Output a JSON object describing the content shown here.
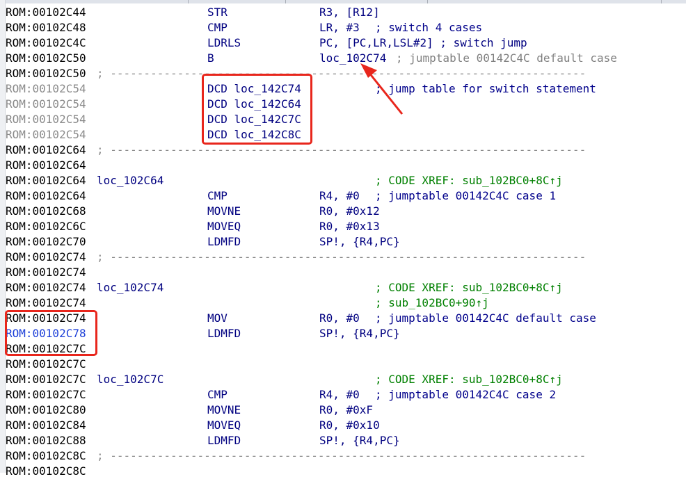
{
  "listing": [
    {
      "addr": "ROM:00102C44",
      "mn": "STR",
      "op": "R3, [R12]"
    },
    {
      "addr": "ROM:00102C48",
      "mn": "CMP",
      "op": "LR, #3",
      "cm": "; switch 4 cases"
    },
    {
      "addr": "ROM:00102C4C",
      "mn": "LDRLS",
      "op": "PC, [PC,LR,LSL#2] ; switch jump"
    },
    {
      "addr": "ROM:00102C50",
      "mn": "B",
      "op": "loc_102C74",
      "auto": "; jumptable 00142C4C default case"
    },
    {
      "addr": "ROM:00102C50",
      "sep": "; -----------------------------------------------------------------------"
    },
    {
      "addr": "ROM:00102C54",
      "dim": true,
      "mn": "DCD loc_142C74",
      "cm": "; jump table for switch statement"
    },
    {
      "addr": "ROM:00102C54",
      "dim": true,
      "mn": "DCD loc_142C64"
    },
    {
      "addr": "ROM:00102C54",
      "dim": true,
      "mn": "DCD loc_142C7C"
    },
    {
      "addr": "ROM:00102C54",
      "dim": true,
      "mn": "DCD loc_142C8C"
    },
    {
      "addr": "ROM:00102C64",
      "sep": "; -----------------------------------------------------------------------"
    },
    {
      "addr": "ROM:00102C64"
    },
    {
      "addr": "ROM:00102C64",
      "label": "loc_102C64",
      "xref": "; CODE XREF: sub_102BC0+8C↑j"
    },
    {
      "addr": "ROM:00102C64",
      "mn": "CMP",
      "op": "R4, #0",
      "cm": "; jumptable 00142C4C case 1"
    },
    {
      "addr": "ROM:00102C68",
      "mn": "MOVNE",
      "op": "R0, #0x12"
    },
    {
      "addr": "ROM:00102C6C",
      "mn": "MOVEQ",
      "op": "R0, #0x13"
    },
    {
      "addr": "ROM:00102C70",
      "mn": "LDMFD",
      "op": "SP!, {R4,PC}"
    },
    {
      "addr": "ROM:00102C74",
      "sep": "; -----------------------------------------------------------------------"
    },
    {
      "addr": "ROM:00102C74"
    },
    {
      "addr": "ROM:00102C74",
      "label": "loc_102C74",
      "xref": "; CODE XREF: sub_102BC0+8C↑j"
    },
    {
      "addr": "ROM:00102C74",
      "xref": "; sub_102BC0+90↑j"
    },
    {
      "addr": "ROM:00102C74",
      "mn": "MOV",
      "op": "R0, #0",
      "cm": "; jumptable 00142C4C default case"
    },
    {
      "addr": "ROM:00102C78",
      "blue": true,
      "mn": "LDMFD",
      "op": "SP!, {R4,PC}"
    },
    {
      "addr": "ROM:00102C7C",
      "sep": ""
    },
    {
      "addr": "ROM:00102C7C"
    },
    {
      "addr": "ROM:00102C7C",
      "label": "loc_102C7C",
      "xref": "; CODE XREF: sub_102BC0+8C↑j"
    },
    {
      "addr": "ROM:00102C7C",
      "mn": "CMP",
      "op": "R4, #0",
      "cm": "; jumptable 00142C4C case 2"
    },
    {
      "addr": "ROM:00102C80",
      "mn": "MOVNE",
      "op": "R0, #0xF"
    },
    {
      "addr": "ROM:00102C84",
      "mn": "MOVEQ",
      "op": "R0, #0x10"
    },
    {
      "addr": "ROM:00102C88",
      "mn": "LDMFD",
      "op": "SP!, {R4,PC}"
    },
    {
      "addr": "ROM:00102C8C",
      "sep": "; -----------------------------------------------------------------------"
    },
    {
      "addr": "ROM:00102C8C"
    }
  ],
  "annotation_color": "#e8261c"
}
